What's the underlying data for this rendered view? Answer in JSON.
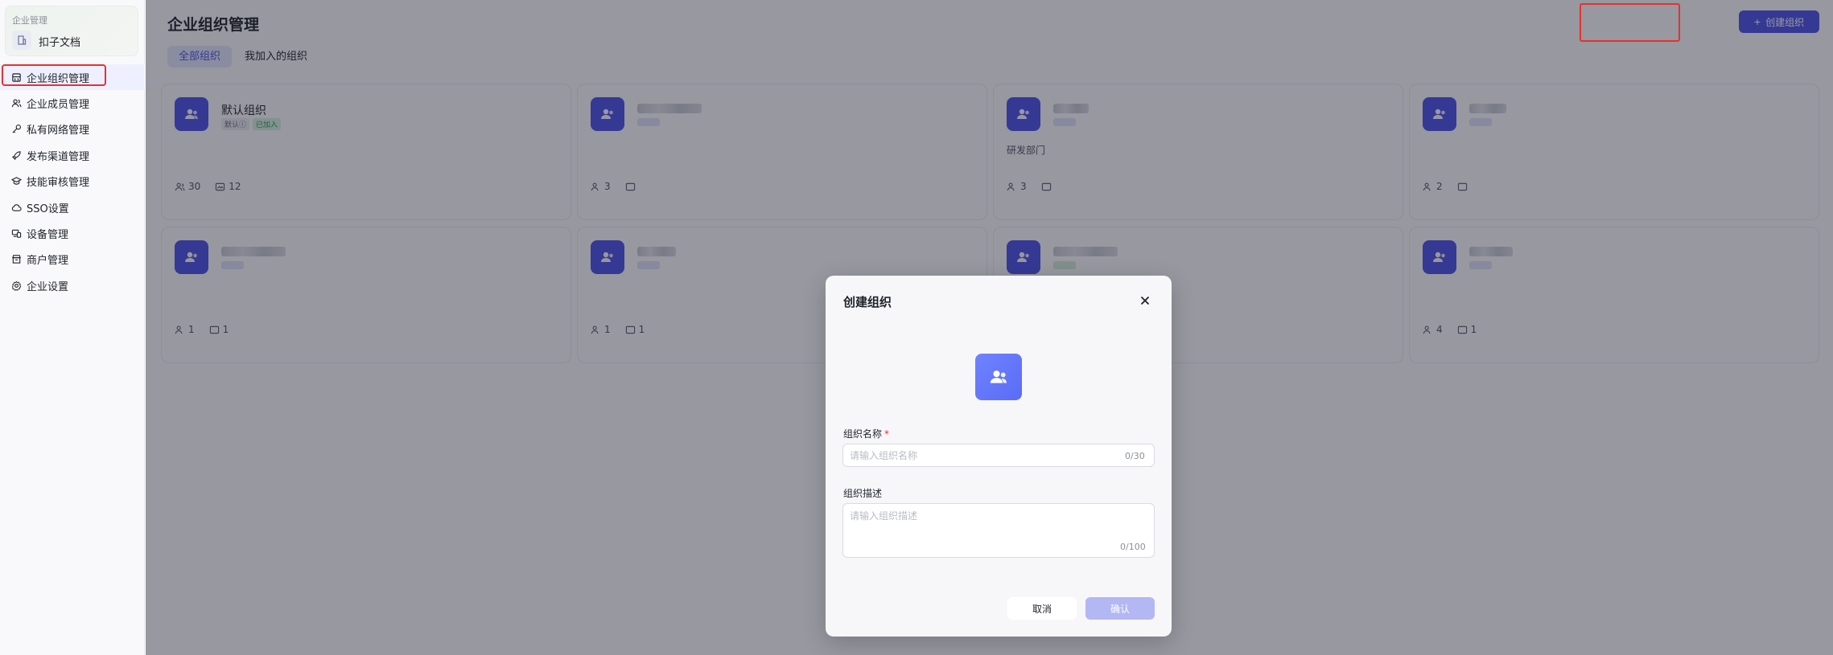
{
  "sidebar": {
    "enterprise_label": "企业管理",
    "enterprise_name": "扣子文档",
    "items": [
      {
        "label": "企业组织管理",
        "icon": "building-icon",
        "active": true
      },
      {
        "label": "企业成员管理",
        "icon": "users-icon",
        "active": false
      },
      {
        "label": "私有网络管理",
        "icon": "key-icon",
        "active": false
      },
      {
        "label": "发布渠道管理",
        "icon": "rocket-icon",
        "active": false
      },
      {
        "label": "技能审核管理",
        "icon": "graduation-cap-icon",
        "active": false
      },
      {
        "label": "SSO设置",
        "icon": "cloud-key-icon",
        "active": false
      },
      {
        "label": "设备管理",
        "icon": "devices-icon",
        "active": false
      },
      {
        "label": "商户管理",
        "icon": "store-icon",
        "active": false
      },
      {
        "label": "企业设置",
        "icon": "gear-icon",
        "active": false
      }
    ]
  },
  "main": {
    "title": "企业组织管理",
    "create_button": "创建组织",
    "tabs": [
      {
        "label": "全部组织",
        "active": true
      },
      {
        "label": "我加入的组织",
        "active": false
      }
    ],
    "cards": [
      {
        "name": "默认组织",
        "blurred": false,
        "tags": [
          {
            "text": "默认ⓘ",
            "style": "gray"
          },
          {
            "text": "已加入",
            "style": "green"
          }
        ],
        "desc": "",
        "members": "30",
        "spaces": "12"
      },
      {
        "name": "",
        "blurred": true,
        "tags": [],
        "desc": "",
        "members": "3",
        "spaces": ""
      },
      {
        "name": "",
        "blurred": true,
        "tags": [],
        "desc": "研发部门",
        "members": "3",
        "spaces": ""
      },
      {
        "name": "",
        "blurred": true,
        "tags": [],
        "desc": "",
        "members": "2",
        "spaces": ""
      },
      {
        "name": "",
        "blurred": true,
        "tags": [],
        "desc": "",
        "members": "1",
        "spaces": "1"
      },
      {
        "name": "",
        "blurred": true,
        "tags": [],
        "desc": "",
        "members": "1",
        "spaces": "1"
      },
      {
        "name": "",
        "blurred": true,
        "tags": [],
        "desc": "",
        "members": "",
        "spaces": ""
      },
      {
        "name": "",
        "blurred": true,
        "tags": [],
        "desc": "",
        "members": "4",
        "spaces": "1"
      }
    ]
  },
  "modal": {
    "title": "创建组织",
    "name_label": "组织名称",
    "required_mark": "*",
    "name_placeholder": "请输入组织名称",
    "name_count": "0/30",
    "desc_label": "组织描述",
    "desc_placeholder": "请输入组织描述",
    "desc_count": "0/100",
    "cancel": "取消",
    "confirm": "确认"
  },
  "colors": {
    "brand": "#4d53e8",
    "highlight": "#e5322d",
    "confirm_disabled": "#b3b7f3"
  }
}
